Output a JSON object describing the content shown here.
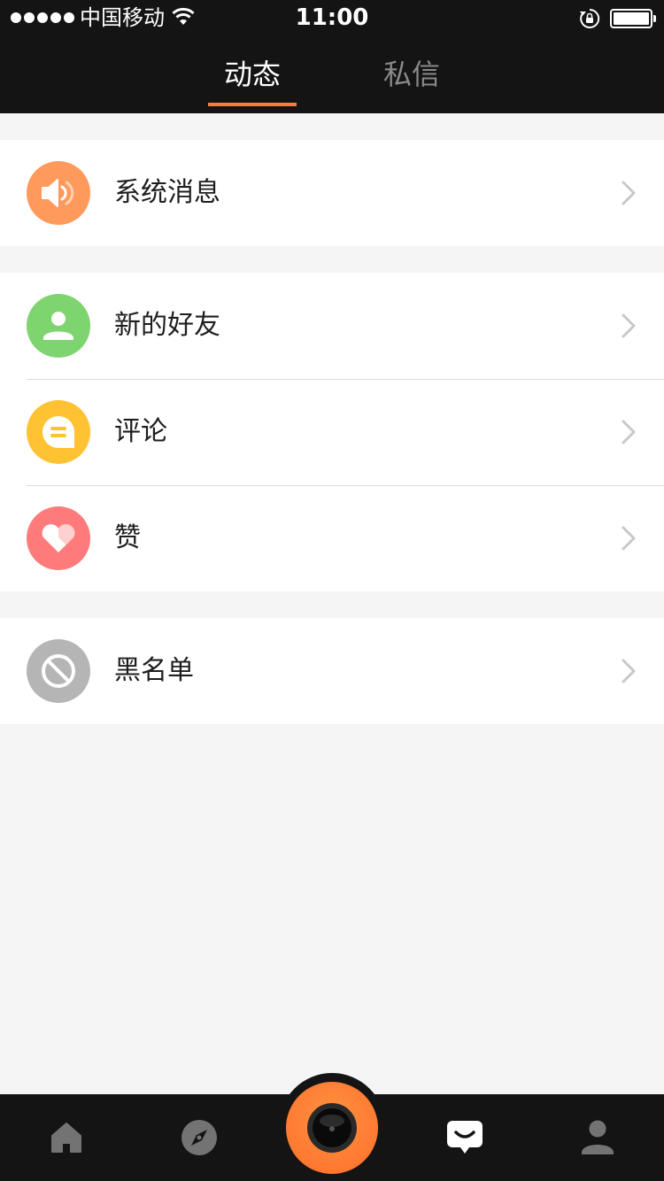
{
  "status_bar": {
    "carrier": "中国移动",
    "time": "11:00"
  },
  "tabs": [
    {
      "label": "动态",
      "active": true
    },
    {
      "label": "私信",
      "active": false
    }
  ],
  "accent_color": "#ff7a3d",
  "groups": [
    {
      "items": [
        {
          "label": "系统消息",
          "icon": "speaker-icon",
          "icon_color": "#ff9a5c"
        }
      ]
    },
    {
      "items": [
        {
          "label": "新的好友",
          "icon": "user-icon",
          "icon_color": "#7ed46e"
        },
        {
          "label": "评论",
          "icon": "comment-icon",
          "icon_color": "#ffc233"
        },
        {
          "label": "赞",
          "icon": "heart-icon",
          "icon_color": "#ff7b7b"
        }
      ]
    },
    {
      "items": [
        {
          "label": "黑名单",
          "icon": "block-icon",
          "icon_color": "#b5b5b5"
        }
      ]
    }
  ],
  "tab_bar": {
    "items": [
      "home-icon",
      "compass-icon",
      "camera-icon",
      "message-icon",
      "profile-icon"
    ],
    "active": "message-icon"
  }
}
